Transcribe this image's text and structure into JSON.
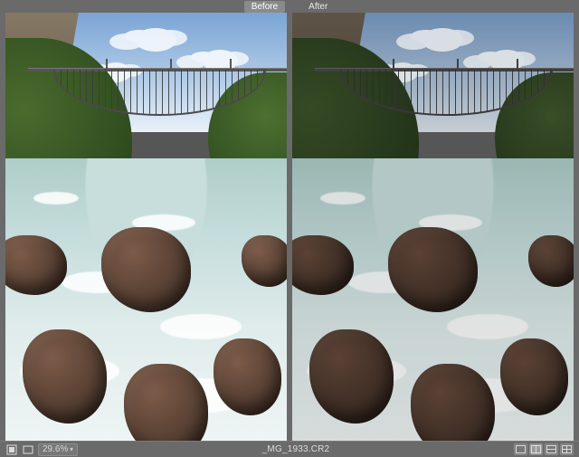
{
  "labels": {
    "before": "Before",
    "after": "After"
  },
  "footer": {
    "zoom": "29.6%",
    "filename": "_MG_1933.CR2"
  },
  "icons": {
    "toggle_preview": "toggle-preview-icon",
    "fullscreen": "fullscreen-icon",
    "zoom_dropdown": "chevron-down-icon",
    "view_single": "view-single-icon",
    "view_split_lr": "view-split-lr-icon",
    "view_split_tb": "view-split-tb-icon",
    "view_swap": "view-swap-icon"
  }
}
